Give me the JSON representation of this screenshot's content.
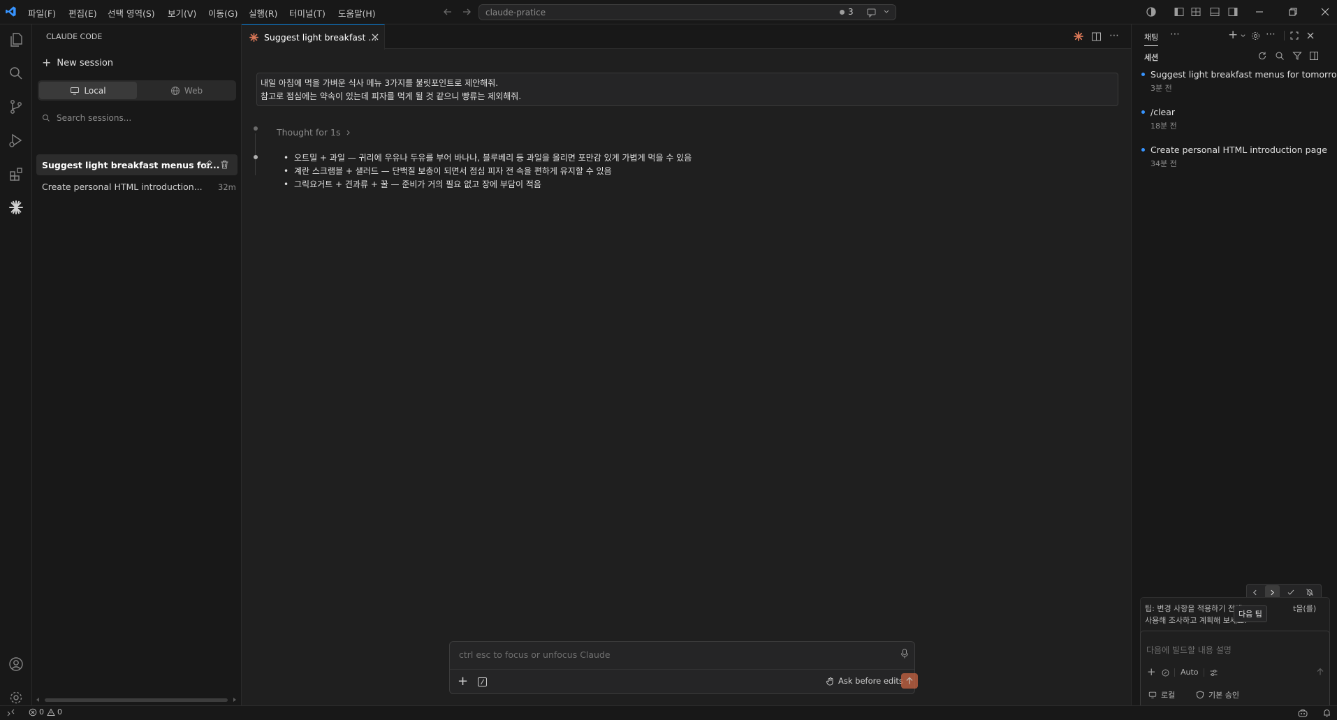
{
  "titlebar": {
    "menus": [
      "파일(F)",
      "편집(E)",
      "선택 영역(S)",
      "보기(V)",
      "이동(G)",
      "실행(R)",
      "터미널(T)",
      "도움말(H)"
    ],
    "search_text": "claude-pratice",
    "badge_count": "3"
  },
  "sidebar": {
    "title": "CLAUDE CODE",
    "new_session": "New session",
    "toggle_local": "Local",
    "toggle_web": "Web",
    "search_placeholder": "Search sessions...",
    "sessions": [
      {
        "title": "Suggest light breakfast menus for...",
        "time": ""
      },
      {
        "title": "Create personal HTML introduction...",
        "time": "32m"
      }
    ]
  },
  "editor": {
    "tab_title": "Suggest light breakfast ...",
    "user_message_line1": "내일 아침에 먹을 가벼운 식사 메뉴 3가지를 불릿포인트로 제안해줘.",
    "user_message_line2": "참고로 점심에는 약속이 있는데 피자를 먹게 될 것 같으니 빵류는 제외해줘.",
    "thought": "Thought for 1s",
    "bullets": [
      "오트밀 + 과일 — 귀리에 우유나 두유를 부어 바나나, 블루베리 등 과일을 올리면 포만감 있게 가볍게 먹을 수 있음",
      "계란 스크램블 + 샐러드 — 단백질 보충이 되면서 점심 피자 전 속을 편하게 유지할 수 있음",
      "그릭요거트 + 견과류 + 꿀 — 준비가 거의 필요 없고 장에 부담이 적음"
    ],
    "input_placeholder": "ctrl esc to focus or unfocus Claude",
    "mode_label": "Ask before edits"
  },
  "rightpanel": {
    "tab_chat": "채팅",
    "section_title": "세션",
    "sessions": [
      {
        "title": "Suggest light breakfast menus for tomorrow",
        "time": "3분 전"
      },
      {
        "title": "/clear",
        "time": "18분 전"
      },
      {
        "title": "Create personal HTML introduction page",
        "time": "34분 전"
      }
    ],
    "tip_line1": "팁: 변경 사항을 적용하기 전에",
    "tip_line1_end": "t을(를)",
    "tip_line2": "사용해 조사하고 계획해 보세요.",
    "tooltip": "다음 팁",
    "chat_placeholder": "다음에 빌드할 내용 설명",
    "auto_label": "Auto",
    "footer_local": "로컬",
    "footer_approve": "기본 승인"
  },
  "statusbar": {
    "errors": "0",
    "warnings": "0"
  },
  "colors": {
    "accent": "#0078d4",
    "claude": "#d97757",
    "send_button": "#c96442"
  }
}
